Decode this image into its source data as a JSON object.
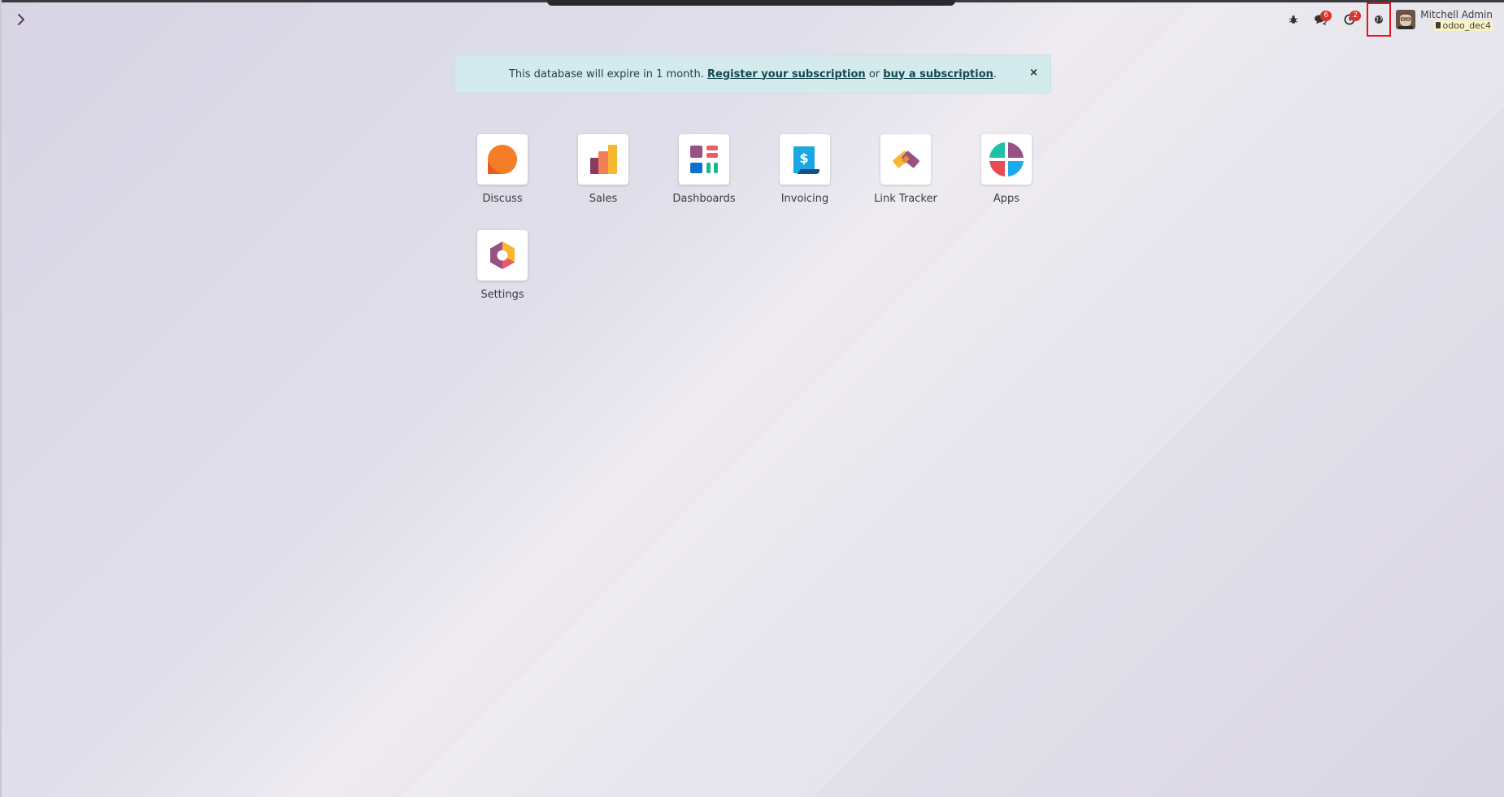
{
  "navbar": {
    "toggle_icon": "chevron-right-icon",
    "systray": {
      "debug_icon": "bug-icon",
      "chat_icon": "comments-icon",
      "chat_badge": "6",
      "activity_icon": "clock-icon",
      "activity_badge": "2",
      "language_icon": "globe-icon"
    },
    "user": {
      "name": "Mitchell Admin",
      "database": "odoo_dec4"
    }
  },
  "alert": {
    "text_prefix": "This database will expire in 1 month.",
    "register_link": "Register your subscription",
    "or_text": "or",
    "buy_link": "buy a subscription",
    "suffix": ".",
    "close_label": "×"
  },
  "apps": [
    {
      "label": "Discuss",
      "icon": "discuss-icon"
    },
    {
      "label": "Sales",
      "icon": "sales-icon"
    },
    {
      "label": "Dashboards",
      "icon": "dashboards-icon"
    },
    {
      "label": "Invoicing",
      "icon": "invoicing-icon"
    },
    {
      "label": "Link Tracker",
      "icon": "link-tracker-icon"
    },
    {
      "label": "Apps",
      "icon": "apps-icon"
    },
    {
      "label": "Settings",
      "icon": "settings-icon"
    }
  ],
  "colors": {
    "alert_bg": "#d4ebed",
    "badge": "#d9342b",
    "highlight_border": "#e0161f",
    "db_bg": "#fbf3c2"
  }
}
